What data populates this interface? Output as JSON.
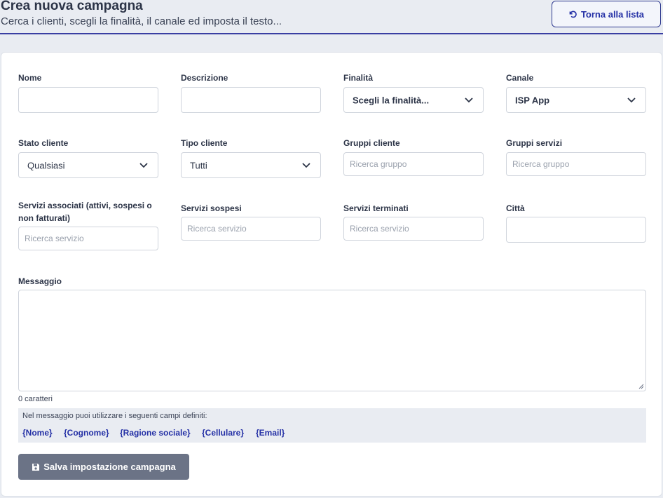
{
  "header": {
    "title": "Crea nuova campagna",
    "subtitle": "Cerca i clienti, scegli la finalità, il canale ed imposta il testo...",
    "back_label": "Torna alla lista"
  },
  "form": {
    "nome": {
      "label": "Nome",
      "value": ""
    },
    "descrizione": {
      "label": "Descrizione",
      "value": ""
    },
    "finalita": {
      "label": "Finalità",
      "value": "Scegli la finalità..."
    },
    "canale": {
      "label": "Canale",
      "value": "ISP App"
    },
    "stato_cliente": {
      "label": "Stato cliente",
      "value": "Qualsiasi"
    },
    "tipo_cliente": {
      "label": "Tipo cliente",
      "value": "Tutti"
    },
    "gruppi_cliente": {
      "label": "Gruppi cliente",
      "placeholder": "Ricerca gruppo"
    },
    "gruppi_servizi": {
      "label": "Gruppi servizi",
      "placeholder": "Ricerca gruppo"
    },
    "servizi_associati": {
      "label_line1": "Servizi associati (attivi, sospesi o",
      "label_line2": "non fatturati)",
      "placeholder": "Ricerca servizio"
    },
    "servizi_sospesi": {
      "label": "Servizi sospesi",
      "placeholder": "Ricerca servizio"
    },
    "servizi_terminati": {
      "label": "Servizi terminati",
      "placeholder": "Ricerca servizio"
    },
    "citta": {
      "label": "Città",
      "value": ""
    },
    "messaggio": {
      "label": "Messaggio",
      "value": "",
      "char_count": "0 caratteri"
    }
  },
  "fields_hint": "Nel messaggio puoi utilizzare i seguenti campi definiti:",
  "fields": [
    "{Nome}",
    "{Cognome}",
    "{Ragione sociale}",
    "{Cellulare}",
    "{Email}"
  ],
  "save_label": "Salva impostazione campagna",
  "colors": {
    "accent": "#2531a6",
    "save_button": "#6b7386",
    "background": "#e9ecf2"
  },
  "icons": {
    "back": "undo-icon",
    "save": "floppy-disk-icon",
    "dropdown": "chevron-down-icon"
  }
}
